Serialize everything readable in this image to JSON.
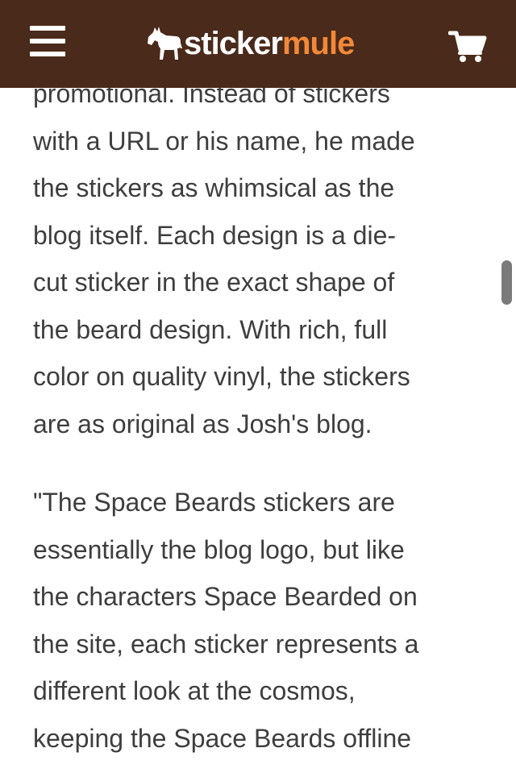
{
  "header": {
    "logo_sticker": "sticker",
    "logo_mule": "mule",
    "menu_icon": "hamburger-menu-icon",
    "cart_icon": "shopping-cart-icon",
    "logo_icon": "mule-logo-icon",
    "background_color": "#4a2a1a",
    "brand_orange": "#f2893a"
  },
  "article": {
    "paragraph_1": {
      "lines": [
        "promotional. Instead of stickers",
        "with a URL or his name, he made",
        "the stickers as whimsical as the",
        "blog itself. Each design is a die-",
        "cut sticker in the exact shape of",
        "the beard design. With rich, full",
        "color on quality vinyl, the stickers",
        "are as original as Josh's blog."
      ]
    },
    "paragraph_2": {
      "lines": [
        "\"The Space Beards stickers are",
        "essentially the blog logo, but like",
        "the characters Space Bearded on",
        "the site, each sticker represents a",
        "different look at the cosmos,",
        "keeping the Space Beards offline"
      ]
    },
    "text_color": "#3e3e3e"
  }
}
